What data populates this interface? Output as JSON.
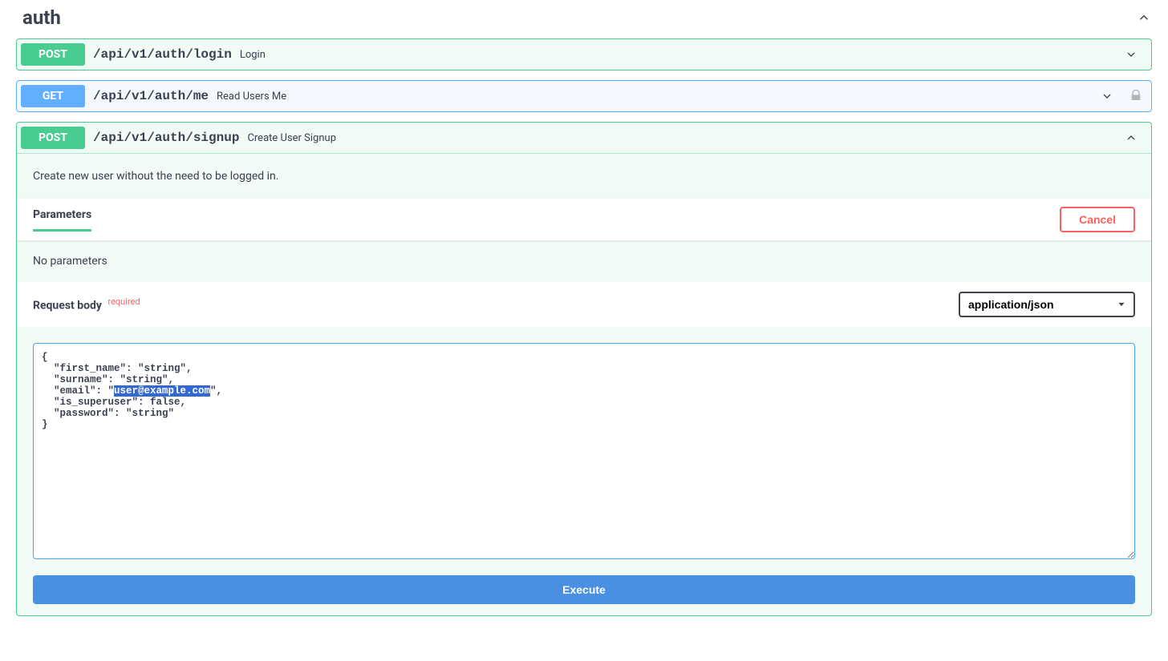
{
  "section": {
    "title": "auth"
  },
  "endpoints": {
    "login": {
      "method": "POST",
      "path": "/api/v1/auth/login",
      "summary": "Login"
    },
    "me": {
      "method": "GET",
      "path": "/api/v1/auth/me",
      "summary": "Read Users Me"
    },
    "signup": {
      "method": "POST",
      "path": "/api/v1/auth/signup",
      "summary": "Create User Signup",
      "description": "Create new user without the need to be logged in."
    }
  },
  "labels": {
    "parameters": "Parameters",
    "cancel": "Cancel",
    "no_parameters": "No parameters",
    "request_body": "Request body",
    "required": "required",
    "execute": "Execute"
  },
  "content_type": {
    "selected": "application/json"
  },
  "request_body_json": {
    "prefix": "{\n  \"first_name\": \"string\",\n  \"surname\": \"string\",\n  \"email\": \"",
    "selected": "user@example.com",
    "suffix": "\",\n  \"is_superuser\": false,\n  \"password\": \"string\"\n}"
  }
}
